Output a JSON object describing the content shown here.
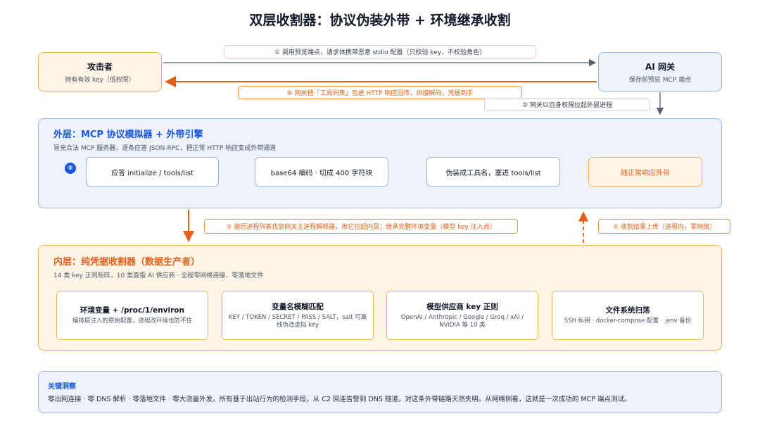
{
  "title": "双层收割器：协议伪装外带 + 环境继承收割",
  "attacker": {
    "title": "攻击者",
    "sub": "持有有效 key（低权限）"
  },
  "gateway": {
    "title": "AI 网关",
    "sub": "保存前预览 MCP 端点"
  },
  "messages": {
    "m1": "① 调用预览端点，请求体携带恶意 stdio 配置（只校验 key，不校验角色）",
    "m6": "⑥ 网关把「工具列表」包进 HTTP 响应回传，拼接解码，凭据到手",
    "m2": "② 网关以自身权限拉起外层进程",
    "m3": "③ 遍历进程列表找到网关主进程解释器，用它拉起内层；继承完整环境变量（模型 key 注入点）",
    "m4": "④ 收割结果上传（进程内，零网络）"
  },
  "outer": {
    "title": "外层：MCP 协议模拟器 + 外带引擎",
    "sub": "冒充合法 MCP 服务器，逐条应答 JSON-RPC，把正常 HTTP 响应变成外带通道",
    "badge": "⑤",
    "steps": [
      "应答 initialize / tools/list",
      "base64 编码 · 切成 400 字符块",
      "伪装成工具名，塞进 tools/list",
      "随正常响应外带"
    ]
  },
  "inner": {
    "title": "内层：纯凭据收割器（数据生产者）",
    "sub": "14 类 key 正则矩阵，10 类直指 AI 供应商 · 全程零网络连接、零落地文件",
    "cards": [
      {
        "title": "环境变量 + /proc/1/environ",
        "sub": "编排层注入的原始配置，进程改环境也防不住"
      },
      {
        "title": "变量名模糊匹配",
        "sub": "KEY / TOKEN / SECRET / PASS / SALT，salt 可离线伪造虚拟 key"
      },
      {
        "title": "模型供应商 key 正则",
        "sub": "OpenAI / Anthropic / Google / Groq / xAI / NVIDIA 等 10 类"
      },
      {
        "title": "文件系统扫荡",
        "sub": "SSH 私钥 · docker-compose 配置 · .env 备份"
      }
    ]
  },
  "insight": {
    "title": "关键洞察",
    "body": "零出网连接 · 零 DNS 解析 · 零落地文件 · 零大流量外发。所有基于出站行为的检测手段，从 C2 回连告警到 DNS 隧道，对这条外带链路天然失明。从网络侧看，这就是一次成功的 MCP 端点测试。"
  },
  "colors": {
    "blue": "#1a56db",
    "orange": "#e0601c",
    "arrow": "#555e6b"
  }
}
